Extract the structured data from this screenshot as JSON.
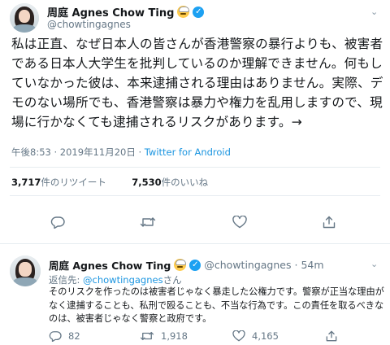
{
  "main_tweet": {
    "display_name": "周庭 Agnes Chow Ting",
    "handle": "@chowtingagnes",
    "text": "私は正直、なぜ日本人の皆さんが香港警察の暴行よりも、被害者である日本人大学生を批判しているのか理解できません。何もしていなかった彼は、本来逮捕される理由はありません。実際、デモのない場所でも、香港警察は暴力や権力を乱用しますので、現場に行かなくても逮捕されるリスクがあります。→",
    "timestamp": "午後8:53 · 2019年11月20日 · ",
    "source": "Twitter for Android",
    "retweets_count": "3,717",
    "retweets_label": "件のリツイート",
    "likes_count": "7,530",
    "likes_label": "件のいいね"
  },
  "reply_tweet": {
    "display_name": "周庭 Agnes Chow Ting",
    "handle": "@chowtingagnes",
    "time": "· 54m",
    "reply_prefix": "返信先: ",
    "reply_mention": "@chowtingagnes",
    "reply_suffix": "さん",
    "text": "そのリスクを作ったのは被害者じゃなく暴走した公権力です。警察が正当な理由がなく逮捕することも、私刑で殴ることも、不当な行為です。この責任を取るべきなのは、被害者じゃなく警察と政府です。",
    "reply_count": "82",
    "retweet_count": "1,918",
    "like_count": "4,165"
  },
  "icons": {
    "verified": "verified-badge-icon",
    "emoji": "grinning-face-emoji-icon",
    "reply": "reply-icon",
    "retweet": "retweet-icon",
    "like": "heart-icon",
    "share": "share-icon",
    "more": "chevron-down-icon"
  },
  "colors": {
    "link": "#1b95e0",
    "verified": "#1da1f2",
    "secondary_text": "#657786",
    "divider": "#e6ecf0"
  }
}
